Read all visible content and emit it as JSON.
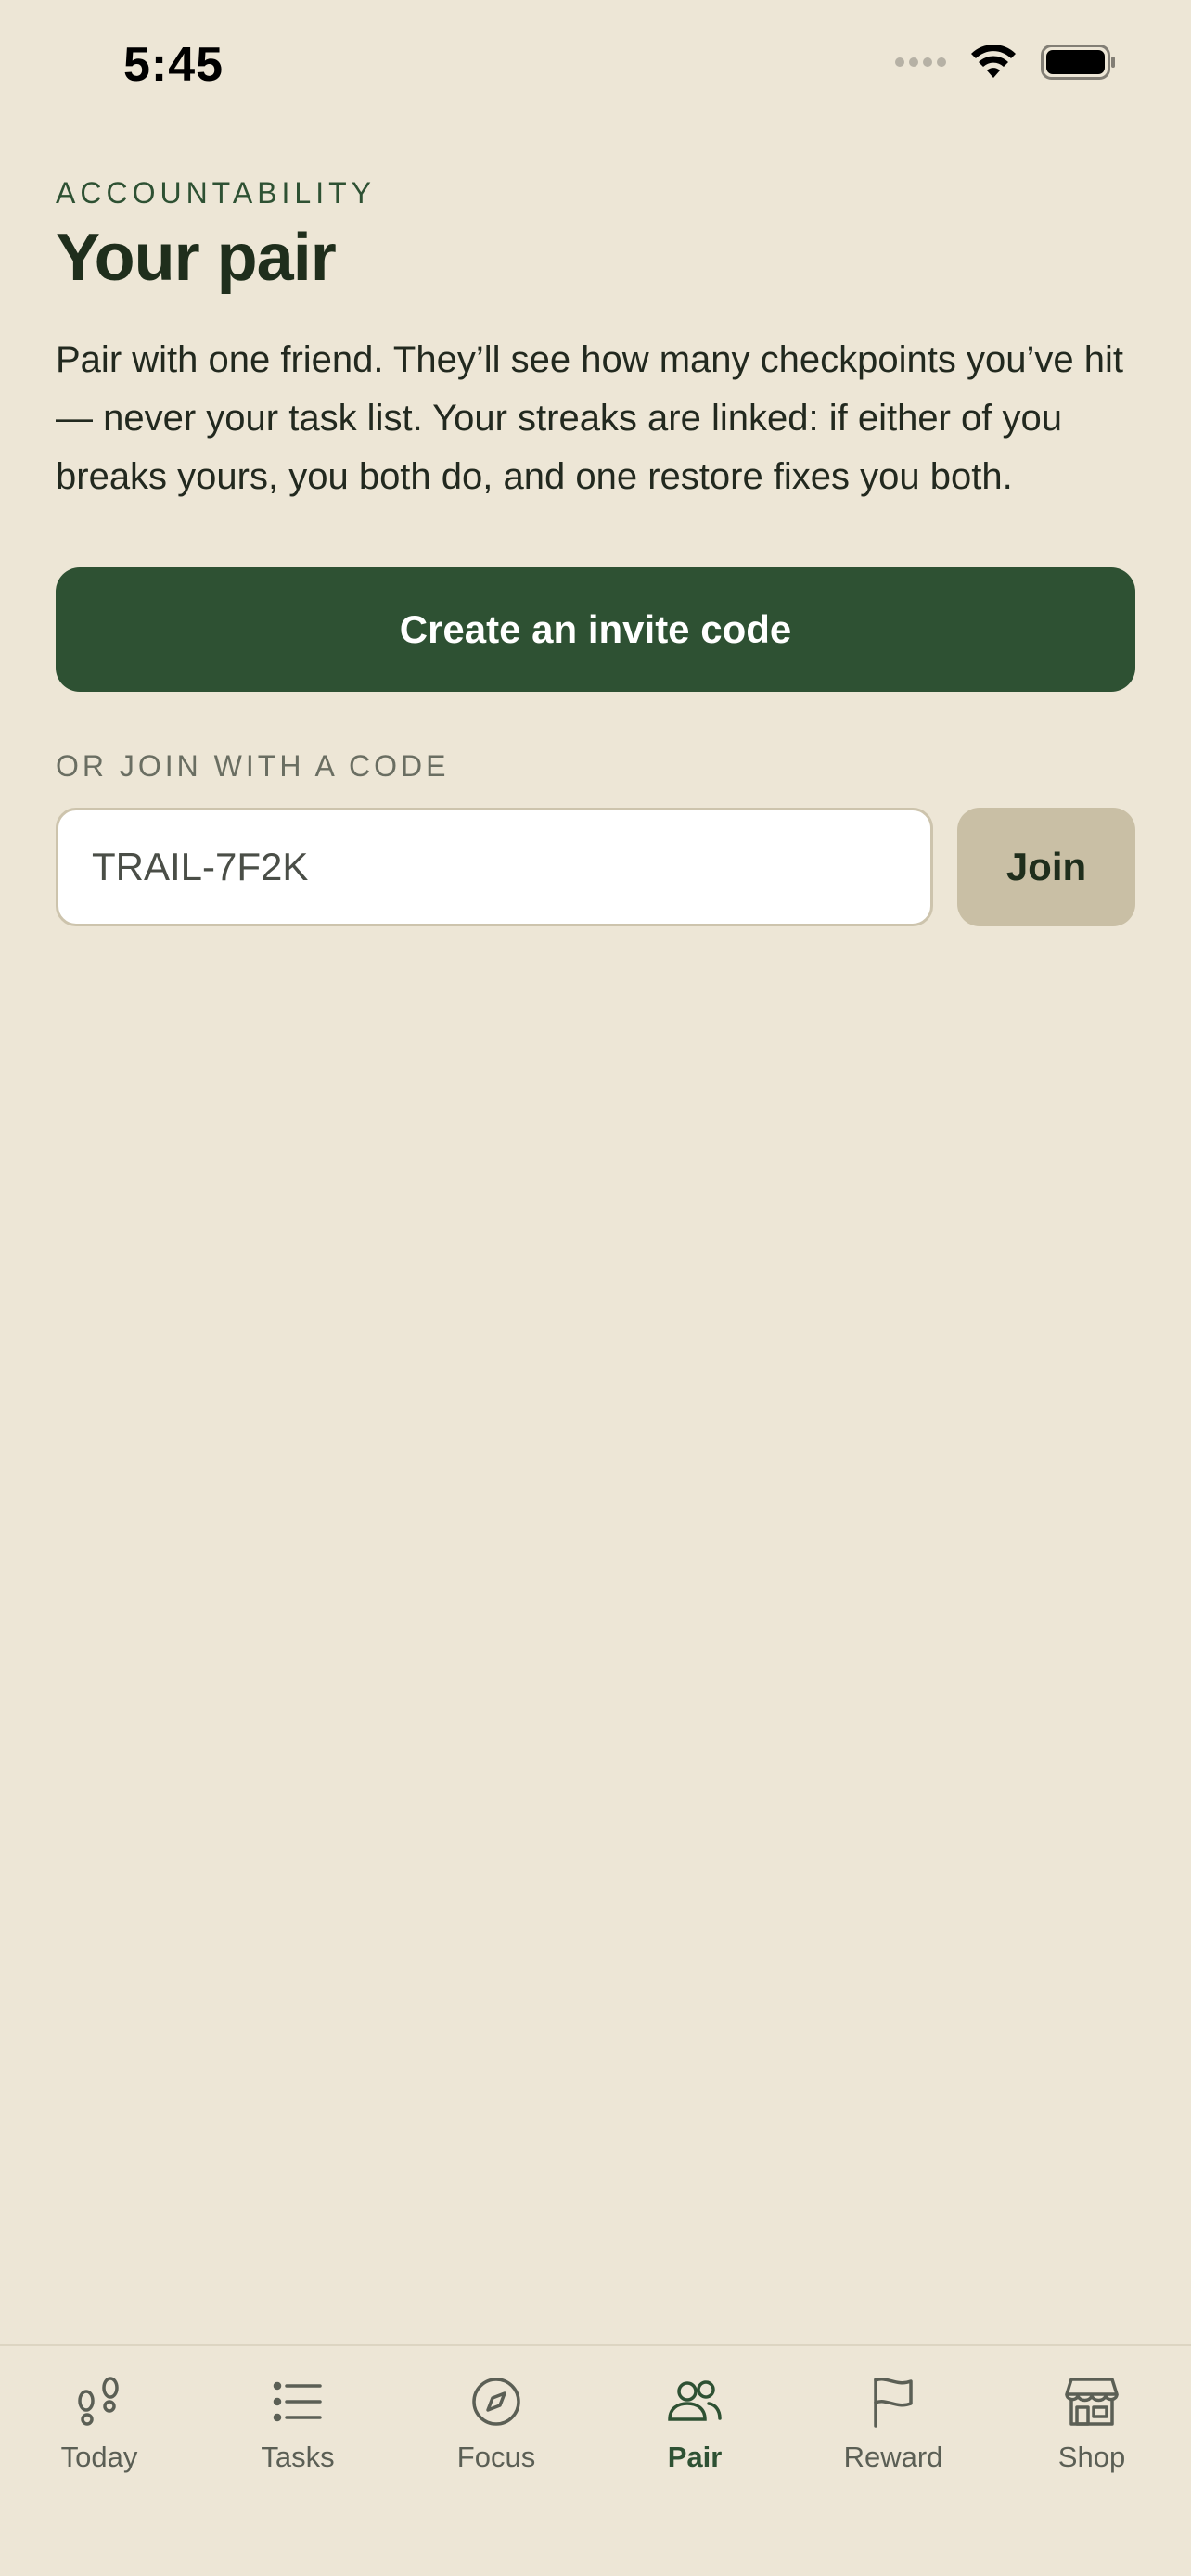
{
  "status_bar": {
    "time": "5:45"
  },
  "header": {
    "eyebrow": "ACCOUNTABILITY",
    "title": "Your pair"
  },
  "main": {
    "description": "Pair with one friend. They’ll see how many checkpoints you’ve hit — never your task list. Your streaks are linked: if either of you breaks yours, you both do, and one restore fixes you both.",
    "create_button_label": "Create an invite code",
    "join_section_label": "OR JOIN WITH A CODE",
    "code_input": {
      "value": "TRAIL-7F2K",
      "placeholder": ""
    },
    "join_button_label": "Join"
  },
  "tab_bar": {
    "active": "pair",
    "tabs": [
      {
        "id": "today",
        "label": "Today",
        "icon": "footprints-icon"
      },
      {
        "id": "tasks",
        "label": "Tasks",
        "icon": "list-icon"
      },
      {
        "id": "focus",
        "label": "Focus",
        "icon": "compass-icon"
      },
      {
        "id": "pair",
        "label": "Pair",
        "icon": "users-icon"
      },
      {
        "id": "reward",
        "label": "Reward",
        "icon": "flag-icon"
      },
      {
        "id": "shop",
        "label": "Shop",
        "icon": "store-icon"
      }
    ]
  },
  "colors": {
    "background": "#EDE6D6",
    "accent": "#2E5133",
    "secondary_button": "#C9BFA5"
  }
}
